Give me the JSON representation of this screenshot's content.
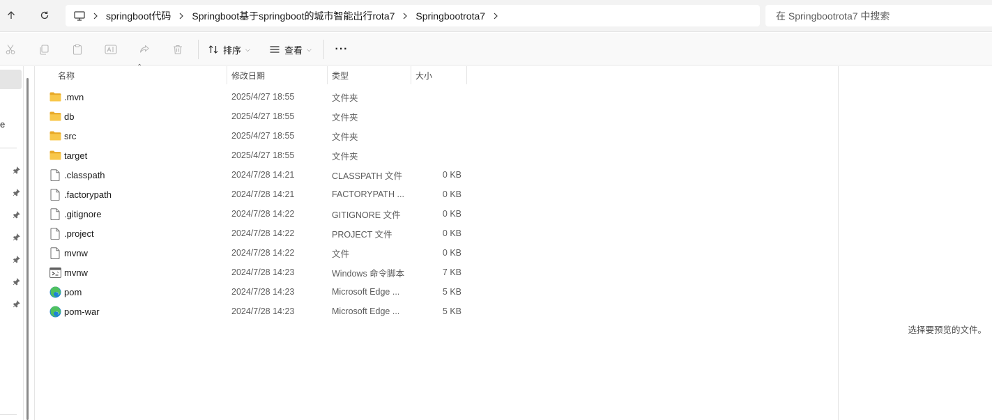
{
  "address": {
    "breadcrumbs": [
      "springboot代码",
      "Springboot基于springboot的城市智能出行rota7",
      "Springbootrota7"
    ],
    "search_placeholder": "在 Springbootrota7 中搜索"
  },
  "toolbar": {
    "sort_label": "排序",
    "view_label": "查看",
    "icons": [
      "cut-icon",
      "copy-icon",
      "paste-icon",
      "rename-icon",
      "share-icon",
      "delete-icon"
    ]
  },
  "nav": {
    "fragment": "e",
    "pin_count": 7
  },
  "columns": {
    "name": "名称",
    "date": "修改日期",
    "type": "类型",
    "size": "大小"
  },
  "files": [
    {
      "name": ".mvn",
      "date": "2025/4/27 18:55",
      "type": "文件夹",
      "size": "",
      "icon": "folder-icon"
    },
    {
      "name": "db",
      "date": "2025/4/27 18:55",
      "type": "文件夹",
      "size": "",
      "icon": "folder-icon"
    },
    {
      "name": "src",
      "date": "2025/4/27 18:55",
      "type": "文件夹",
      "size": "",
      "icon": "folder-icon"
    },
    {
      "name": "target",
      "date": "2025/4/27 18:55",
      "type": "文件夹",
      "size": "",
      "icon": "folder-icon"
    },
    {
      "name": ".classpath",
      "date": "2024/7/28 14:21",
      "type": "CLASSPATH 文件",
      "size": "0 KB",
      "icon": "file-icon"
    },
    {
      "name": ".factorypath",
      "date": "2024/7/28 14:21",
      "type": "FACTORYPATH ...",
      "size": "0 KB",
      "icon": "file-icon"
    },
    {
      "name": ".gitignore",
      "date": "2024/7/28 14:22",
      "type": "GITIGNORE 文件",
      "size": "0 KB",
      "icon": "file-icon"
    },
    {
      "name": ".project",
      "date": "2024/7/28 14:22",
      "type": "PROJECT 文件",
      "size": "0 KB",
      "icon": "file-icon"
    },
    {
      "name": "mvnw",
      "date": "2024/7/28 14:22",
      "type": "文件",
      "size": "0 KB",
      "icon": "file-icon"
    },
    {
      "name": "mvnw",
      "date": "2024/7/28 14:23",
      "type": "Windows 命令脚本",
      "size": "7 KB",
      "icon": "script-icon"
    },
    {
      "name": "pom",
      "date": "2024/7/28 14:23",
      "type": "Microsoft Edge ...",
      "size": "5 KB",
      "icon": "edge-icon"
    },
    {
      "name": "pom-war",
      "date": "2024/7/28 14:23",
      "type": "Microsoft Edge ...",
      "size": "5 KB",
      "icon": "edge-icon"
    }
  ],
  "preview": {
    "message": "选择要预览的文件。"
  },
  "colors": {
    "folder": "#f8c74a",
    "folder_dark": "#e8a928",
    "edge_blue": "#1c82d6",
    "edge_green": "#4fc15f",
    "selection": "#e5e5e5"
  }
}
